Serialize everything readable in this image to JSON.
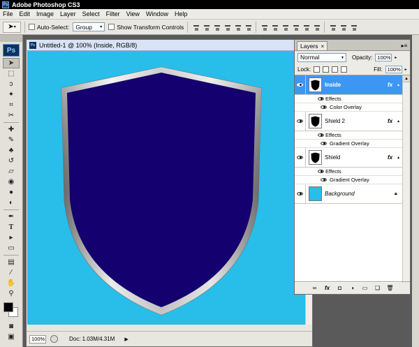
{
  "app": {
    "title": "Adobe Photoshop CS3",
    "logo": "Ps"
  },
  "menu": [
    "File",
    "Edit",
    "Image",
    "Layer",
    "Select",
    "Filter",
    "View",
    "Window",
    "Help"
  ],
  "options": {
    "auto_select_label": "Auto-Select:",
    "auto_select_value": "Group",
    "transform_label": "Show Transform Controls"
  },
  "document": {
    "title": "Untitled-1 @ 100% (Inside, RGB/8)",
    "zoom": "100%",
    "doc_size": "Doc: 1.03M/4.31M",
    "canvas_color": "#29bdea",
    "shield_color": "#14006e"
  },
  "layers_panel": {
    "tab": "Layers",
    "blend_mode": "Normal",
    "opacity_label": "Opacity:",
    "opacity": "100%",
    "lock_label": "Lock:",
    "fill_label": "Fill:",
    "fill": "100%",
    "fx_label": "fx",
    "effects_label": "Effects",
    "layers": [
      {
        "name": "Inside",
        "selected": true,
        "effect": "Color Overlay"
      },
      {
        "name": "Shield 2",
        "selected": false,
        "effect": "Gradient Overlay"
      },
      {
        "name": "Shield",
        "selected": false,
        "effect": "Gradient Overlay"
      },
      {
        "name": "Background",
        "selected": false,
        "effect": ""
      }
    ]
  }
}
